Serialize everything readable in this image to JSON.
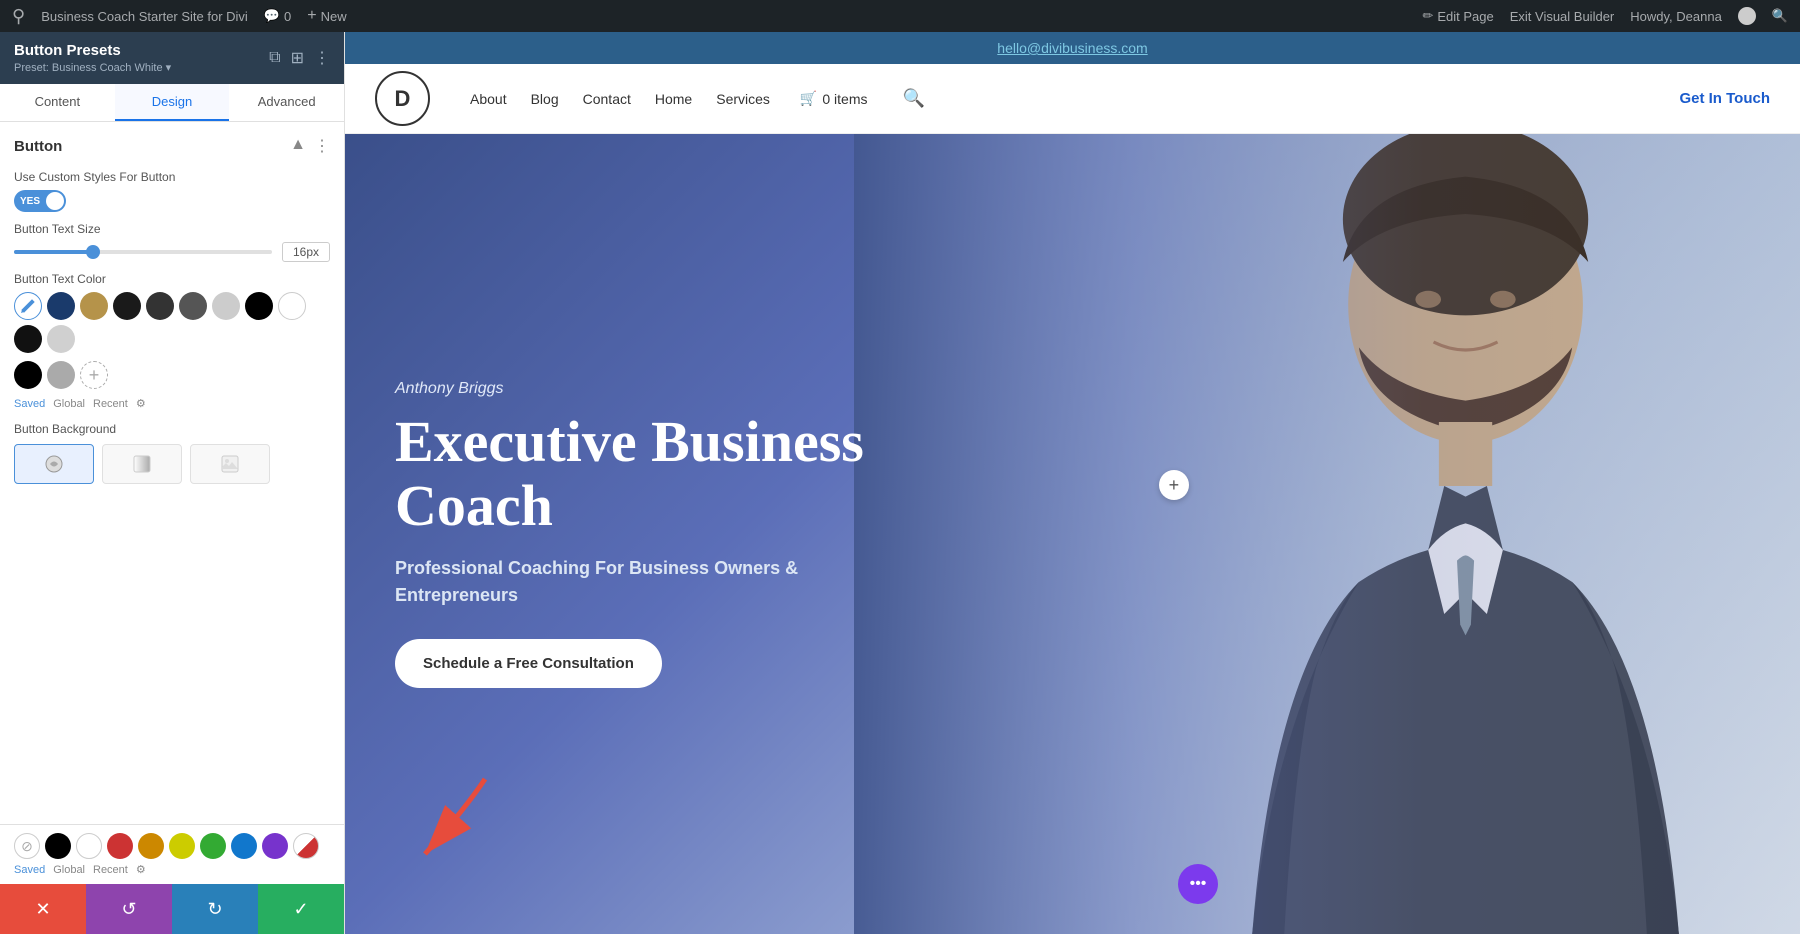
{
  "admin_bar": {
    "wp_icon": "W",
    "site_name": "Business Coach Starter Site for Divi",
    "comments_count": "0",
    "new_label": "New",
    "edit_page_label": "Edit Page",
    "exit_builder_label": "Exit Visual Builder",
    "howdy_label": "Howdy, Deanna"
  },
  "left_panel": {
    "title": "Button Presets",
    "preset": "Preset: Business Coach White",
    "tabs": [
      {
        "label": "Content",
        "active": false
      },
      {
        "label": "Design",
        "active": true
      },
      {
        "label": "Advanced",
        "active": false
      }
    ],
    "section": {
      "title": "Button",
      "custom_styles_label": "Use Custom Styles For Button",
      "toggle_value": "YES",
      "text_size_label": "Button Text Size",
      "text_size_value": "16px",
      "text_color_label": "Button Text Color",
      "colors_saved_label": "Saved",
      "colors_global_label": "Global",
      "colors_recent_label": "Recent",
      "bg_label": "Button Background"
    },
    "bottom_colors": {
      "saved_label": "Saved",
      "global_label": "Global",
      "recent_label": "Recent"
    },
    "action_bar": {
      "close_icon": "✕",
      "undo_icon": "↺",
      "redo_icon": "↻",
      "check_icon": "✓"
    }
  },
  "site": {
    "email": "hello@divibusiness.com",
    "logo_text": "D",
    "nav_links": [
      {
        "label": "About"
      },
      {
        "label": "Blog"
      },
      {
        "label": "Contact"
      },
      {
        "label": "Home"
      },
      {
        "label": "Services"
      }
    ],
    "cart_icon": "🛒",
    "cart_items": "0 items",
    "cta_label": "Get In Touch",
    "hero": {
      "subtitle": "Anthony Briggs",
      "title_line1": "Executive Business",
      "title_line2": "Coach",
      "description": "Professional Coaching For Business Owners &\nEntrepreneurs",
      "cta_button": "Schedule a Free Consultation"
    }
  },
  "colors": {
    "text_swatches": [
      {
        "color": "#4a90d9",
        "selected": true
      },
      {
        "color": "#1a3a6b"
      },
      {
        "color": "#b5934a"
      },
      {
        "color": "#1a1a1a"
      },
      {
        "color": "#222222"
      },
      {
        "color": "#444444"
      },
      {
        "color": "#cccccc"
      },
      {
        "color": "#000000"
      },
      {
        "color": "#ffffff"
      },
      {
        "color": "#000000"
      },
      {
        "color": "#e0e0e0"
      }
    ],
    "row2": [
      {
        "color": "#000000"
      },
      {
        "color": "#888888"
      }
    ],
    "bottom_swatches": [
      {
        "color": "transparent"
      },
      {
        "color": "#000000"
      },
      {
        "color": "#ffffff"
      },
      {
        "color": "#cc3333"
      },
      {
        "color": "#cc8800"
      },
      {
        "color": "#cccc00"
      },
      {
        "color": "#33aa33"
      },
      {
        "color": "#1177cc"
      },
      {
        "color": "#7733cc"
      },
      {
        "color": "#cc3333",
        "diagonal": true
      }
    ]
  }
}
